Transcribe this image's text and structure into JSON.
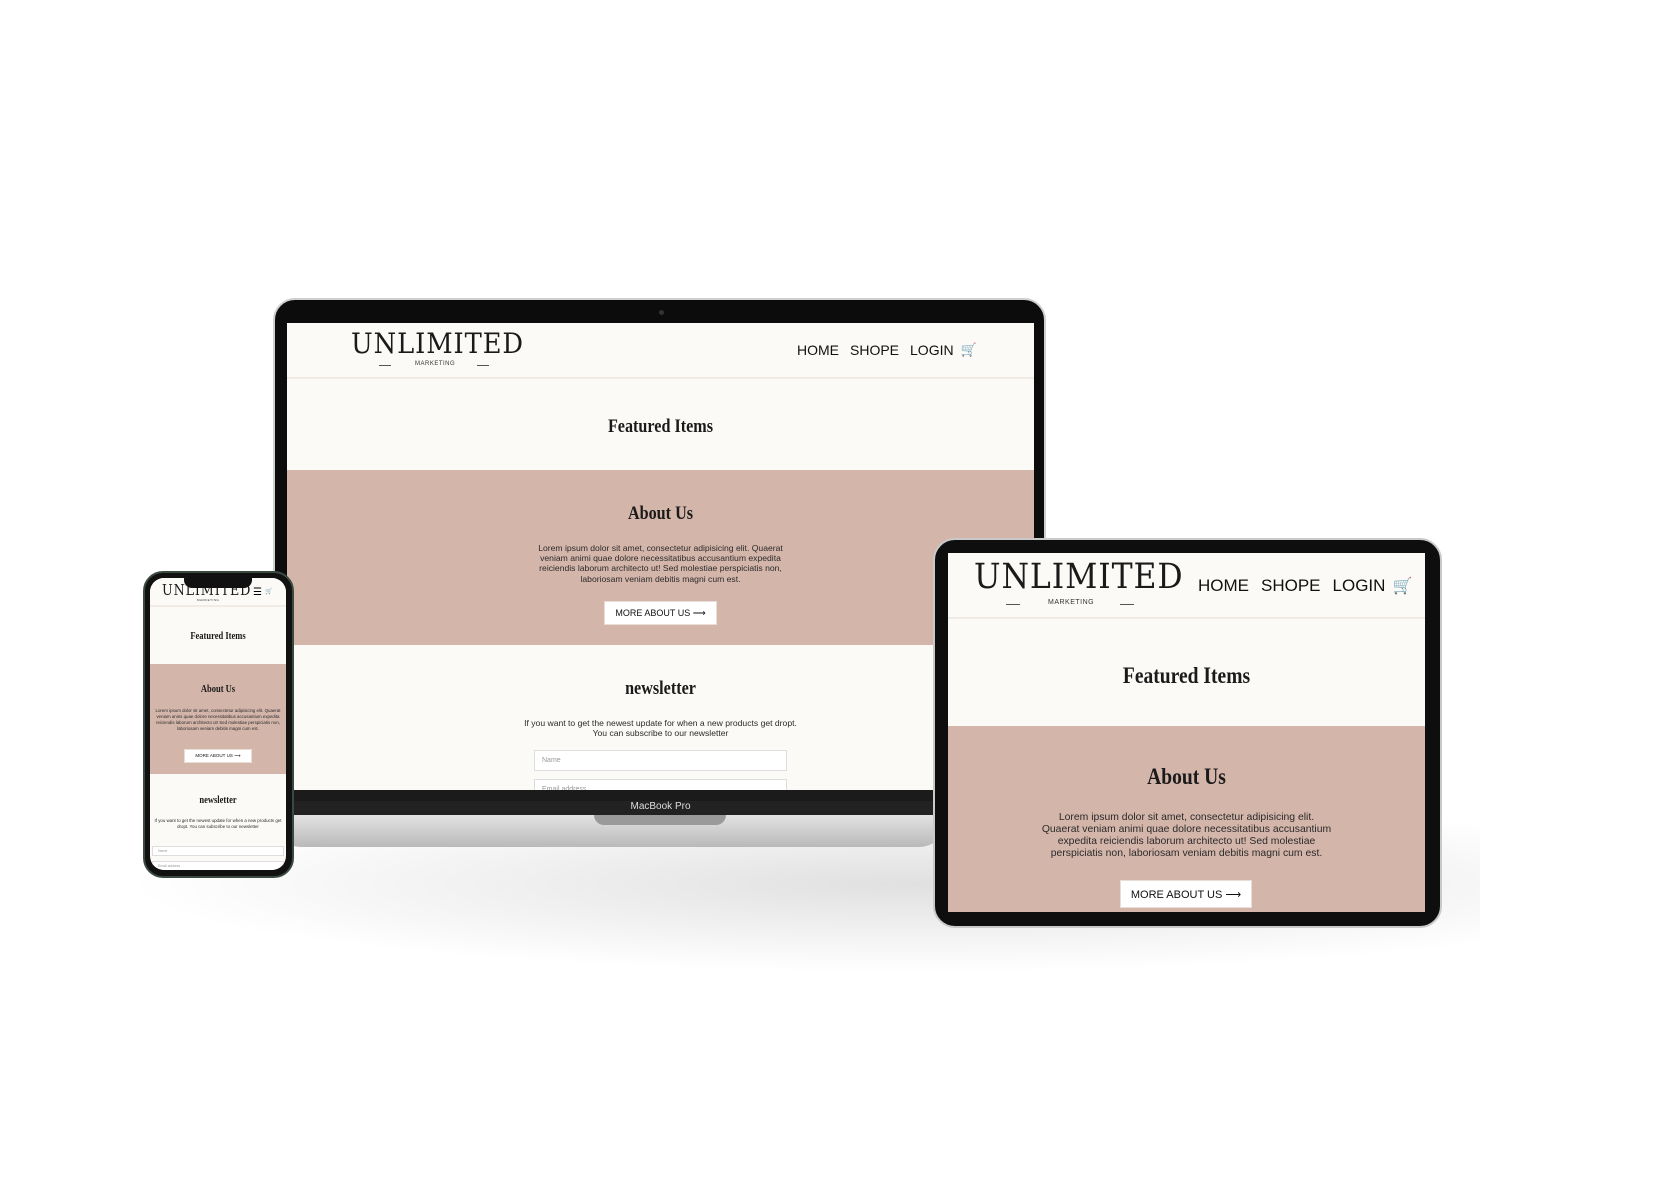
{
  "site": {
    "logo": "UNLIMITED",
    "logo_sub": "MARKETING",
    "nav": [
      "HOME",
      "SHOPE",
      "LOGIN"
    ],
    "featured_title": "Featured Items",
    "about_title": "About Us",
    "about_text": "Lorem ipsum dolor sit amet, consectetur adipisicing elit. Quaerat veniam animi quae dolore necessitatibus accusantium expedita reiciendis laborum architecto ut! Sed molestiae perspiciatis non, laboriosam veniam debitis magni cum est.",
    "about_button": "MORE ABOUT US ⟶",
    "newsletter_title": "newsletter",
    "newsletter_text": "If you want to get the newest update for when a new products get dropt. You can subscribe to our newsletter",
    "name_placeholder": "Name",
    "email_placeholder": "Email address"
  },
  "laptop": {
    "label": "MacBook Pro"
  },
  "colors": {
    "pink": "#d4b5aa",
    "cream": "#fcfaf6"
  }
}
